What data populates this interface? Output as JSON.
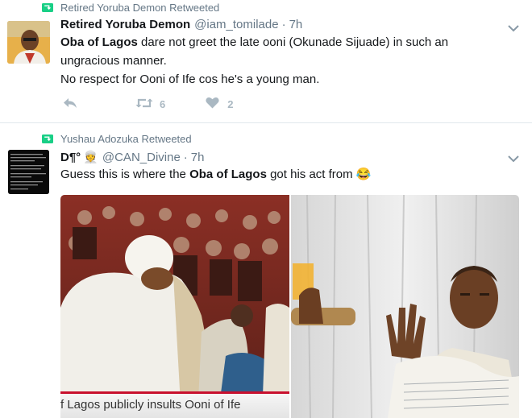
{
  "tweets": [
    {
      "retweeted_by": "Retired Yoruba Demon Retweeted",
      "name": "Retired Yoruba Demon",
      "handle": "@iam_tomilade",
      "separator": "·",
      "time": "7h",
      "line1_bold": "Oba of Lagos",
      "line1_rest": " dare not greet the late ooni (Okunade Sijuade) in such an",
      "line2": "ungracious manner.",
      "line3": "No respect for Ooni of Ife cos he's a young man.",
      "retweet_count": "6",
      "like_count": "2"
    },
    {
      "retweeted_by": "Yushau Adozuka Retweeted",
      "name": "D¶°",
      "name_emoji": "👳",
      "handle": "@CAN_Divine",
      "separator": "·",
      "time": "7h",
      "text_pre": "Guess this is where the ",
      "text_bold": "Oba of Lagos",
      "text_post": " got his act from ",
      "text_emoji": "😂",
      "image_caption": "f Lagos publicly insults Ooni of Ife"
    }
  ],
  "colors": {
    "retweet_green": "#19cf86",
    "secondary_text": "#657786",
    "action_icon": "#aab8c2",
    "caption_accent": "#c8102e"
  },
  "icons": {
    "retweet_indicator": "retweet-icon",
    "reply": "reply-icon",
    "retweet": "retweet-icon",
    "like": "heart-icon",
    "menu": "chevron-down-icon"
  }
}
